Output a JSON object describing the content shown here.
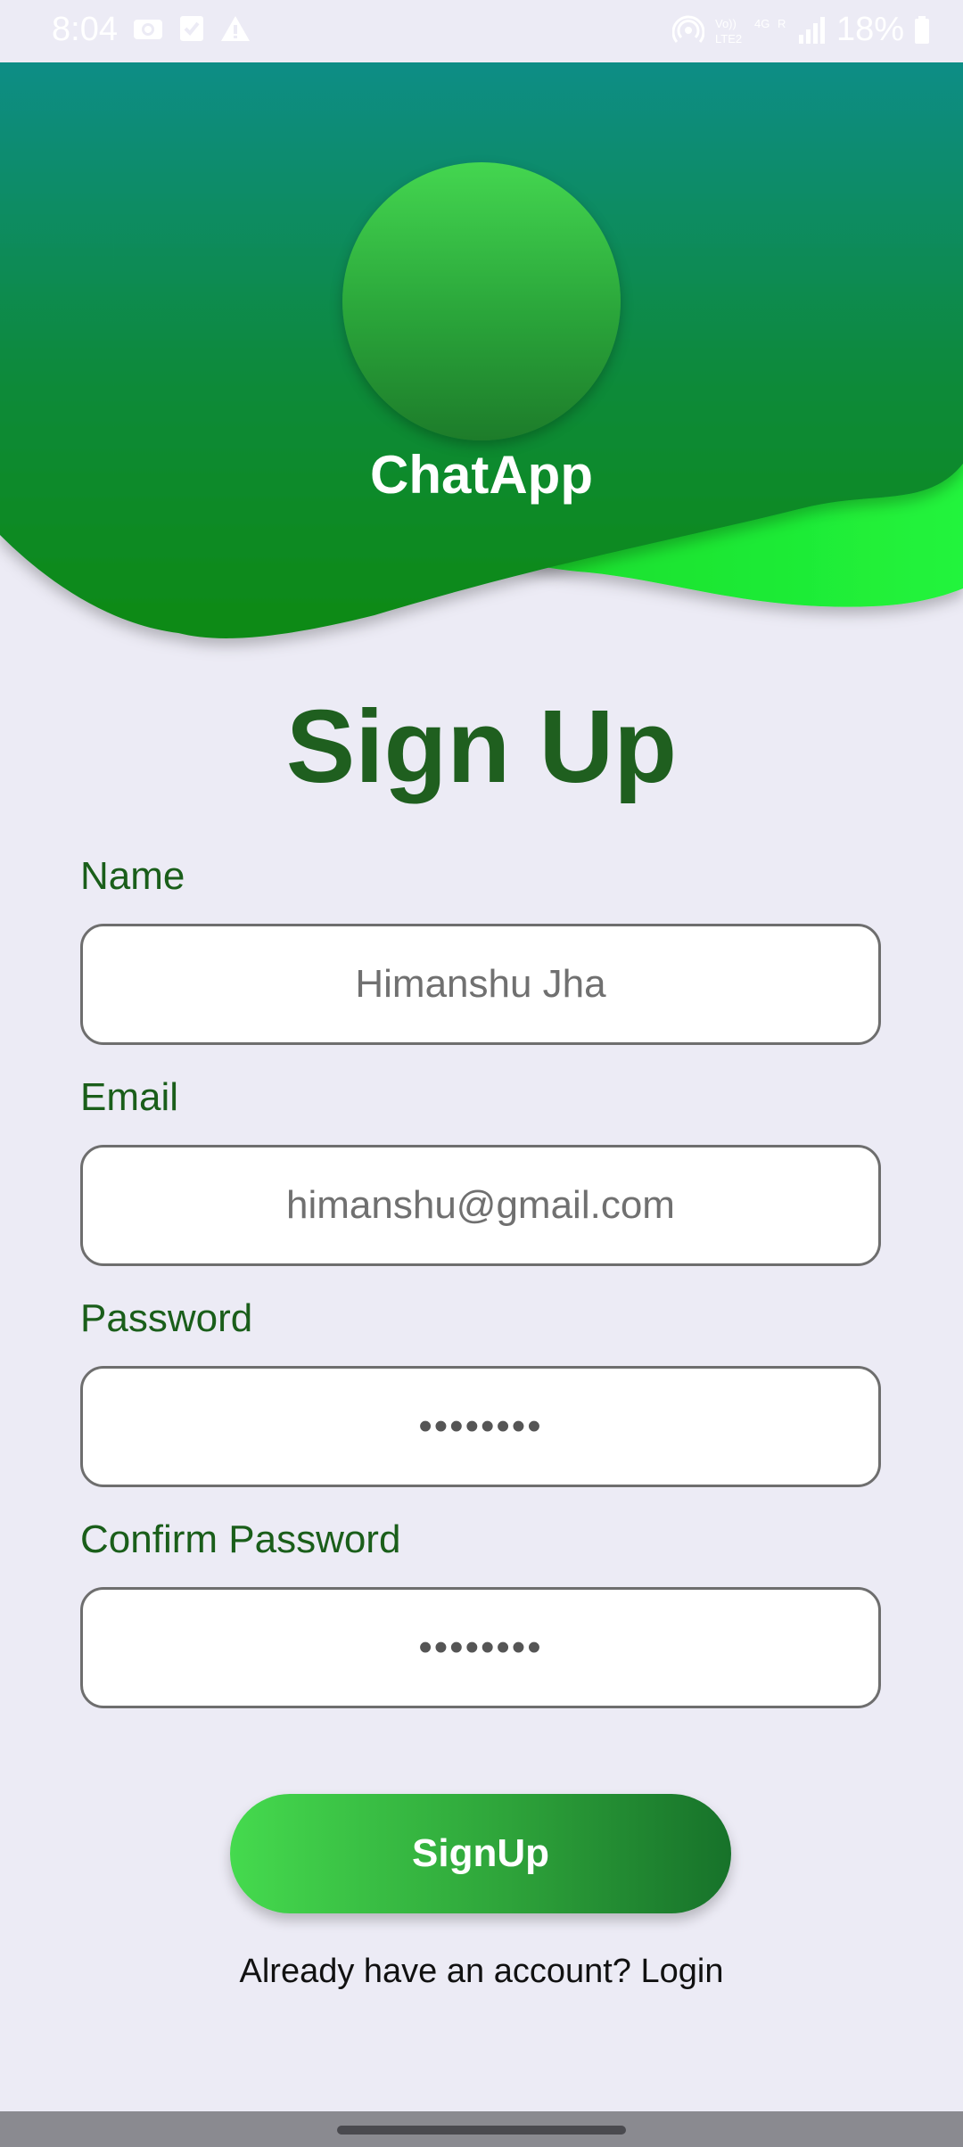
{
  "status_bar": {
    "time": "8:04",
    "battery": "18%",
    "left_icons": [
      "camera-icon",
      "check-icon",
      "warning-icon"
    ],
    "right_icons": [
      "hotspot-icon",
      "volte-icon",
      "signal-icon",
      "battery-icon"
    ]
  },
  "header": {
    "app_name": "ChatApp"
  },
  "form": {
    "title": "Sign Up",
    "name_label": "Name",
    "name_value": "Himanshu Jha",
    "email_label": "Email",
    "email_value": "himanshu@gmail.com",
    "password_label": "Password",
    "password_value": "••••••••",
    "confirm_label": "Confirm Password",
    "confirm_value": "••••••••",
    "signup_button": "SignUp",
    "login_prompt": "Already have an account? Login"
  },
  "colors": {
    "accent": "#2e9e3a",
    "title": "#1f5f1f",
    "background": "#ecebf5"
  }
}
